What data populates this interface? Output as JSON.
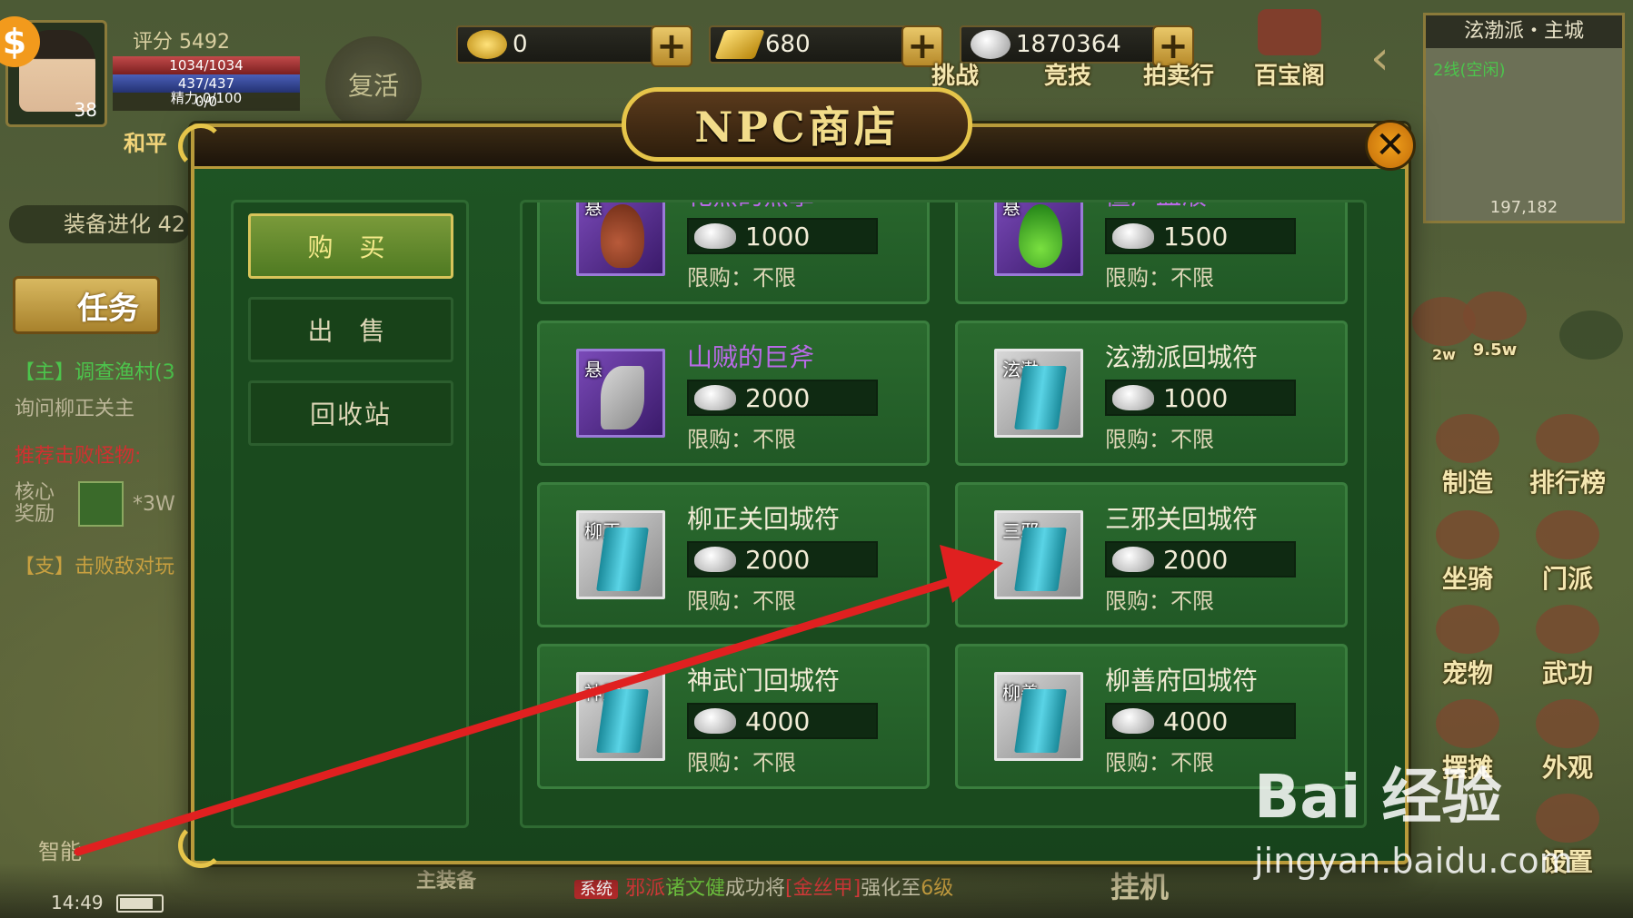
{
  "topbar": {
    "gold_ingot": "0",
    "gold_bar": "680",
    "silver": "1870364",
    "icons": [
      {
        "label": "挑战",
        "icon": "challenge-icon"
      },
      {
        "label": "竞技",
        "icon": "arena-icon"
      },
      {
        "label": "拍卖行",
        "icon": "auction-icon"
      },
      {
        "label": "百宝阁",
        "icon": "treasure-icon"
      }
    ]
  },
  "player": {
    "score_label": "评分 5492",
    "hp": "1034/1034",
    "mp": "437/437",
    "xp": "0/0",
    "energy": "精力:0/100",
    "level": "38",
    "mode": "和平",
    "revive": "复活"
  },
  "left_panel": {
    "equip_evo": "装备进化 42",
    "task_tab": "任务",
    "quest_main": "【主】调查渔村(3",
    "quest_main_desc": "询问柳正关主",
    "quest_recommend": "推荐击败怪物:",
    "core_reward_label": "核心奖励",
    "core_reward_value": "*3W",
    "quest_side": "【支】击败敌对玩",
    "smart": "智能"
  },
  "minimap": {
    "title": "泫渤派・主城",
    "line": "2线(空闲)",
    "coords": "197,182"
  },
  "right_icons": [
    "制造",
    "排行榜",
    "坐骑",
    "门派",
    "宠物",
    "武功",
    "摆摊",
    "外观",
    "设置"
  ],
  "right_small": {
    "a": "2w",
    "b": "9.5w"
  },
  "shop": {
    "title": "NPC商店",
    "tabs": [
      "购 买",
      "出 售",
      "回收站"
    ],
    "items": [
      {
        "name": "花熊的熊掌",
        "tag": "悬",
        "price": "1000",
        "limit": "限购：不限",
        "icon": "drumstick-icon"
      },
      {
        "name": "僵尸血液",
        "tag": "悬",
        "price": "1500",
        "limit": "限购：不限",
        "icon": "drop-icon"
      },
      {
        "name": "山贼的巨斧",
        "tag": "悬",
        "price": "2000",
        "limit": "限购：不限",
        "icon": "axe-icon"
      },
      {
        "name": "泫渤派回城符",
        "tag": "泫渤",
        "price": "1000",
        "limit": "限购：不限",
        "icon": "scroll-icon"
      },
      {
        "name": "柳正关回城符",
        "tag": "柳正",
        "price": "2000",
        "limit": "限购：不限",
        "icon": "scroll-icon"
      },
      {
        "name": "三邪关回城符",
        "tag": "三邪",
        "price": "2000",
        "limit": "限购：不限",
        "icon": "scroll-icon"
      },
      {
        "name": "神武门回城符",
        "tag": "神武",
        "price": "4000",
        "limit": "限购：不限",
        "icon": "scroll-icon"
      },
      {
        "name": "柳善府回城符",
        "tag": "柳善",
        "price": "4000",
        "limit": "限购：不限",
        "icon": "scroll-icon"
      }
    ]
  },
  "bottom": {
    "time": "14:49",
    "sys_tag": "系统",
    "sys_a": "邪派",
    "sys_b": "诸文健",
    "sys_c": "成功将",
    "sys_d": "[金丝甲]",
    "sys_e": "强化至",
    "sys_f": "6级",
    "btn_equip": "主装备",
    "btn_auto": "挂机"
  },
  "watermark": {
    "main": "Bai 经验",
    "sub": "jingyan.baidu.com"
  },
  "colors": {
    "accent_gold": "#e6c54a",
    "panel_green": "#1f5524",
    "annotation_red": "#e02020"
  }
}
